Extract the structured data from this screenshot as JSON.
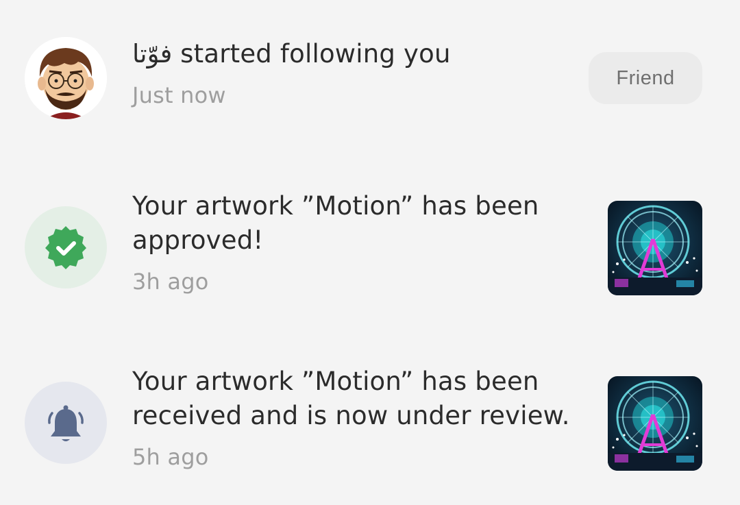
{
  "notifications": [
    {
      "type": "follow",
      "user_name": "فوّتا",
      "action_text": " started following you",
      "time": "Just now",
      "button_label": "Friend",
      "icon": "user-avatar"
    },
    {
      "type": "approved",
      "message": "Your artwork ”Motion” has been approved!",
      "time": "3h ago",
      "icon": "verified-badge-icon",
      "icon_color": "#3fa85a",
      "icon_bg": "#e4efe6"
    },
    {
      "type": "review",
      "message": "Your artwork ”Motion” has been received and is now under review.",
      "time": "5h ago",
      "icon": "bell-icon",
      "icon_color": "#5a6a8c",
      "icon_bg": "#e5e7ee"
    }
  ]
}
